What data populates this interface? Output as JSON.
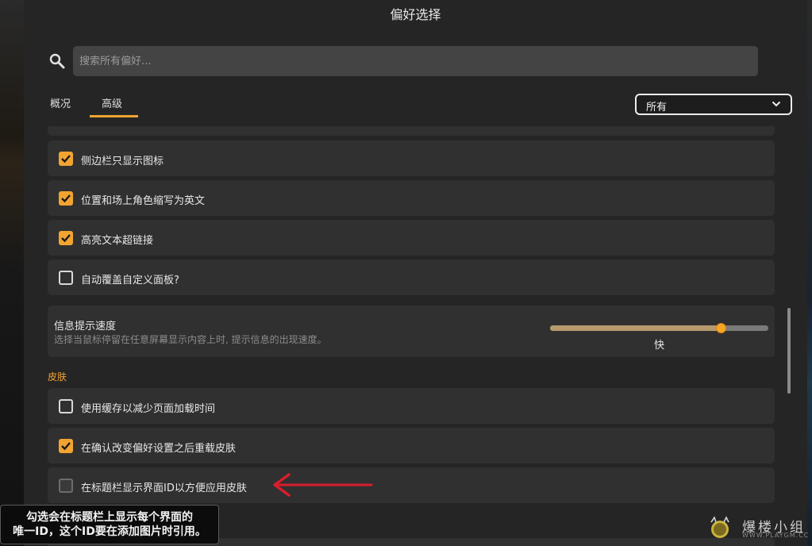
{
  "window": {
    "title": "偏好选择"
  },
  "search": {
    "placeholder": "搜索所有偏好..."
  },
  "tabs": [
    {
      "label": "概况",
      "active": false
    },
    {
      "label": "高级",
      "active": true
    }
  ],
  "filter": {
    "selected": "所有"
  },
  "settings": [
    {
      "label": "侧边栏只显示图标",
      "checked": true
    },
    {
      "label": "位置和场上角色缩写为英文",
      "checked": true
    },
    {
      "label": "高亮文本超链接",
      "checked": true
    },
    {
      "label": "自动覆盖自定义面板?",
      "checked": false
    }
  ],
  "tooltip_speed": {
    "title": "信息提示速度",
    "description": "选择当鼠标停留在任意屏幕显示内容上时, 提示信息的出现速度。",
    "value_label": "快",
    "level": 0.78
  },
  "skin_section": {
    "label": "皮肤",
    "settings": [
      {
        "label": "使用缓存以减少页面加载时间",
        "checked": false
      },
      {
        "label": "在确认改变偏好设置之后重载皮肤",
        "checked": true
      },
      {
        "label": "在标题栏显示界面ID以方便应用皮肤",
        "checked": false
      }
    ]
  },
  "annotation": {
    "line1": "勾选会在标题栏上显示每个界面的",
    "line2": "唯一ID，这个ID要在添加图片时引用。"
  },
  "watermark": {
    "text": "爆楼小组",
    "sub": "WWW.PLAYGM.CC"
  },
  "colors": {
    "accent": "#f2a431",
    "arrow": "#d81e2c",
    "row_bg": "#303030",
    "dialog_bg": "#252525"
  }
}
